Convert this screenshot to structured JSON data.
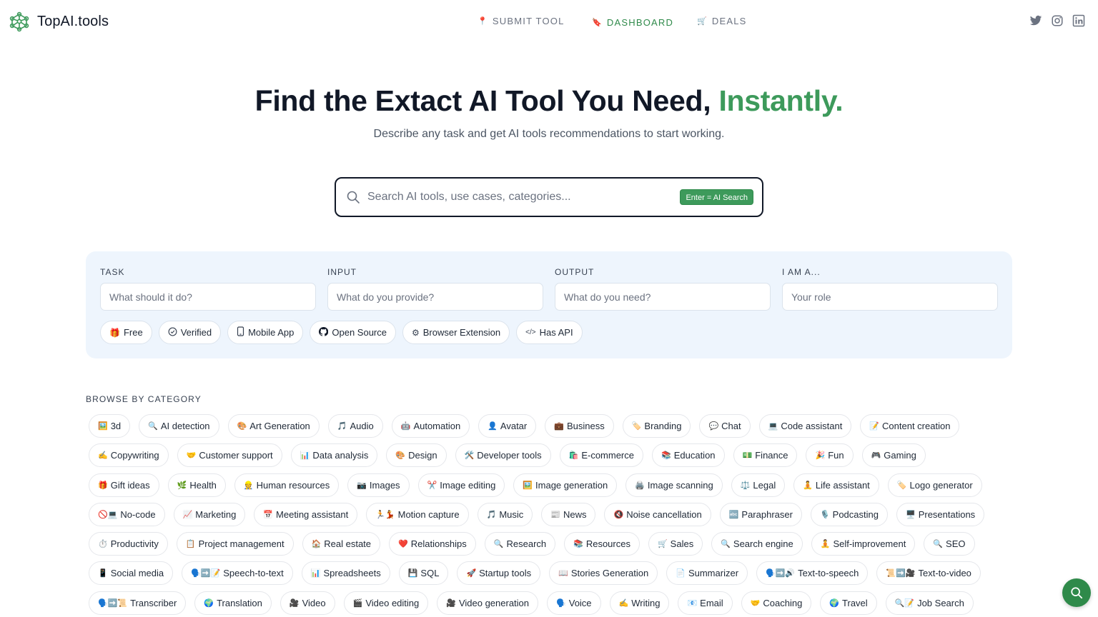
{
  "brand": {
    "name": "TopAI.tools"
  },
  "nav": {
    "items": [
      {
        "label": "SUBMIT TOOL",
        "icon": "pin-icon",
        "glyph": "📍"
      },
      {
        "label": "DASHBOARD",
        "icon": "bookmark-icon",
        "glyph": "🔖"
      },
      {
        "label": "DEALS",
        "icon": "cart-icon",
        "glyph": "🛒"
      }
    ]
  },
  "social": [
    "twitter-icon",
    "instagram-icon",
    "linkedin-icon"
  ],
  "hero": {
    "title_main": "Find the Extact AI Tool You Need, ",
    "title_accent": "Instantly.",
    "subtitle": "Describe any task and get AI tools recommendations to start working."
  },
  "search": {
    "placeholder": "Search AI tools, use cases, categories...",
    "badge": "Enter = AI Search"
  },
  "filters": {
    "fields": [
      {
        "label": "TASK",
        "placeholder": "What should it do?"
      },
      {
        "label": "INPUT",
        "placeholder": "What do you provide?"
      },
      {
        "label": "OUTPUT",
        "placeholder": "What do you need?"
      },
      {
        "label": "I AM A...",
        "placeholder": "Your role"
      }
    ],
    "chips": [
      {
        "label": "Free",
        "icon": "gift-icon",
        "glyph": "🎁"
      },
      {
        "label": "Verified",
        "icon": "check-circle-icon",
        "glyph": "✓"
      },
      {
        "label": "Mobile App",
        "icon": "phone-icon",
        "glyph": "▯"
      },
      {
        "label": "Open Source",
        "icon": "github-icon",
        "glyph": "●"
      },
      {
        "label": "Browser Extension",
        "icon": "puzzle-icon",
        "glyph": "⚙"
      },
      {
        "label": "Has API",
        "icon": "code-icon",
        "glyph": "</>"
      }
    ]
  },
  "categories": {
    "heading": "BROWSE BY CATEGORY",
    "rows": [
      [
        {
          "e": "🖼️",
          "label": "3d"
        },
        {
          "e": "🔍",
          "label": "AI detection"
        },
        {
          "e": "🎨",
          "label": "Art Generation"
        },
        {
          "e": "🎵",
          "label": "Audio"
        },
        {
          "e": "🤖",
          "label": "Automation"
        },
        {
          "e": "👤",
          "label": "Avatar"
        },
        {
          "e": "💼",
          "label": "Business"
        },
        {
          "e": "🏷️",
          "label": "Branding"
        },
        {
          "e": "💬",
          "label": "Chat"
        },
        {
          "e": "💻",
          "label": "Code assistant"
        },
        {
          "e": "📝",
          "label": "Content creation"
        }
      ],
      [
        {
          "e": "✍️",
          "label": "Copywriting"
        },
        {
          "e": "🤝",
          "label": "Customer support"
        },
        {
          "e": "📊",
          "label": "Data analysis"
        },
        {
          "e": "🎨",
          "label": "Design"
        },
        {
          "e": "🛠️",
          "label": "Developer tools"
        },
        {
          "e": "🛍️",
          "label": "E-commerce"
        },
        {
          "e": "📚",
          "label": "Education"
        },
        {
          "e": "💵",
          "label": "Finance"
        },
        {
          "e": "🎉",
          "label": "Fun"
        },
        {
          "e": "🎮",
          "label": "Gaming"
        }
      ],
      [
        {
          "e": "🎁",
          "label": "Gift ideas"
        },
        {
          "e": "🌿",
          "label": "Health"
        },
        {
          "e": "👷",
          "label": "Human resources"
        },
        {
          "e": "📷",
          "label": "Images"
        },
        {
          "e": "✂️",
          "label": "Image editing"
        },
        {
          "e": "🖼️",
          "label": "Image generation"
        },
        {
          "e": "🖨️",
          "label": "Image scanning"
        },
        {
          "e": "⚖️",
          "label": "Legal"
        },
        {
          "e": "🧘",
          "label": "Life assistant"
        },
        {
          "e": "🏷️",
          "label": "Logo generator"
        }
      ],
      [
        {
          "e": "🚫💻",
          "label": "No-code"
        },
        {
          "e": "📈",
          "label": "Marketing"
        },
        {
          "e": "📅",
          "label": "Meeting assistant"
        },
        {
          "e": "🏃💃",
          "label": "Motion capture"
        },
        {
          "e": "🎵",
          "label": "Music"
        },
        {
          "e": "📰",
          "label": "News"
        },
        {
          "e": "🔇",
          "label": "Noise cancellation"
        },
        {
          "e": "🔤",
          "label": "Paraphraser"
        },
        {
          "e": "🎙️",
          "label": "Podcasting"
        },
        {
          "e": "🖥️",
          "label": "Presentations"
        }
      ],
      [
        {
          "e": "⏱️",
          "label": "Productivity"
        },
        {
          "e": "📋",
          "label": "Project management"
        },
        {
          "e": "🏠",
          "label": "Real estate"
        },
        {
          "e": "❤️",
          "label": "Relationships"
        },
        {
          "e": "🔍",
          "label": "Research"
        },
        {
          "e": "📚",
          "label": "Resources"
        },
        {
          "e": "🛒",
          "label": "Sales"
        },
        {
          "e": "🔍",
          "label": "Search engine"
        },
        {
          "e": "🧘",
          "label": "Self-improvement"
        },
        {
          "e": "🔍",
          "label": "SEO"
        }
      ],
      [
        {
          "e": "📱",
          "label": "Social media"
        },
        {
          "e": "🗣️➡️📝",
          "label": "Speech-to-text"
        },
        {
          "e": "📊",
          "label": "Spreadsheets"
        },
        {
          "e": "💾",
          "label": "SQL"
        },
        {
          "e": "🚀",
          "label": "Startup tools"
        },
        {
          "e": "📖",
          "label": "Stories Generation"
        },
        {
          "e": "📄",
          "label": "Summarizer"
        },
        {
          "e": "🗣️➡️🔊",
          "label": "Text-to-speech"
        },
        {
          "e": "📜➡️🎥",
          "label": "Text-to-video"
        }
      ],
      [
        {
          "e": "🗣️➡️📜",
          "label": "Transcriber"
        },
        {
          "e": "🌍",
          "label": "Translation"
        },
        {
          "e": "🎥",
          "label": "Video"
        },
        {
          "e": "🎬",
          "label": "Video editing"
        },
        {
          "e": "🎥",
          "label": "Video generation"
        },
        {
          "e": "🗣️",
          "label": "Voice"
        },
        {
          "e": "✍️",
          "label": "Writing"
        },
        {
          "e": "📧",
          "label": "Email"
        },
        {
          "e": "🤝",
          "label": "Coaching"
        },
        {
          "e": "🌍",
          "label": "Travel"
        },
        {
          "e": "🔍📝",
          "label": "Job Search"
        }
      ]
    ]
  },
  "colors": {
    "accent": "#3d9a5b",
    "panel": "#eef5fd",
    "text": "#111827"
  },
  "fab": {
    "icon": "search-icon"
  }
}
